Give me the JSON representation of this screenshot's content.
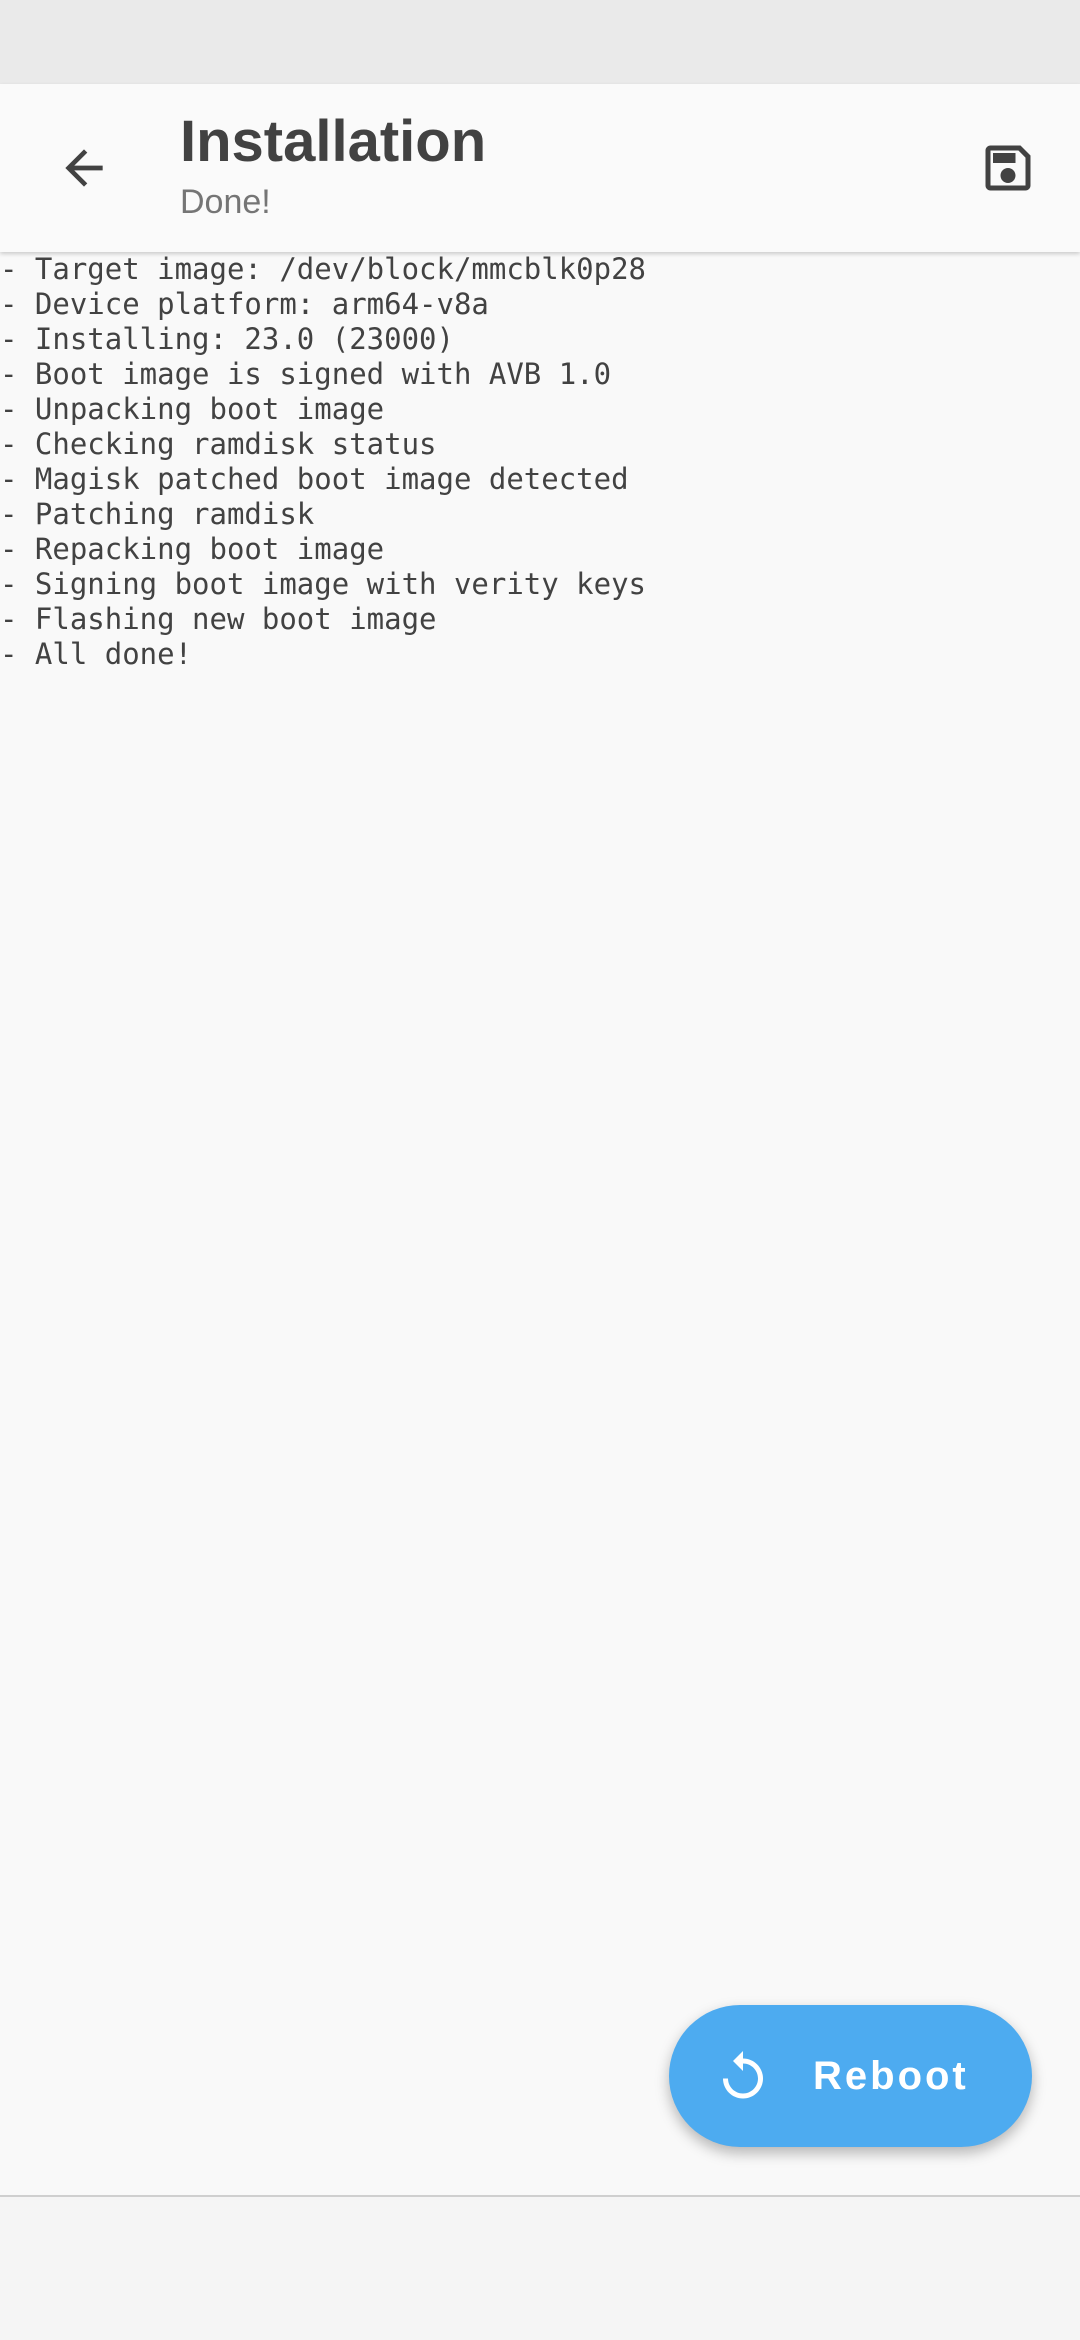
{
  "header": {
    "title": "Installation",
    "subtitle": "Done!",
    "back_icon": "arrow-back-icon",
    "save_icon": "save-icon"
  },
  "log": {
    "lines": [
      "- Target image: /dev/block/mmcblk0p28",
      "- Device platform: arm64-v8a",
      "- Installing: 23.0 (23000)",
      "- Boot image is signed with AVB 1.0",
      "- Unpacking boot image",
      "- Checking ramdisk status",
      "- Magisk patched boot image detected",
      "- Patching ramdisk",
      "- Repacking boot image",
      "- Signing boot image with verity keys",
      "- Flashing new boot image",
      "- All done!"
    ]
  },
  "fab": {
    "label": "Reboot",
    "icon": "restart-icon"
  },
  "colors": {
    "accent": "#4dabf0",
    "text_primary": "#424242",
    "text_secondary": "#757575",
    "background": "#f9f9f9"
  }
}
